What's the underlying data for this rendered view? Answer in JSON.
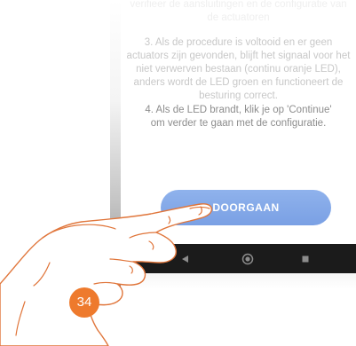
{
  "screen": {
    "previous_step_text": "verifieer de aansluitingen en de configuratie van de actuatoren",
    "step3_text": "3. Als de procedure is voltooid en er geen actuators zijn gevonden, blijft het signaal voor het niet verwerven bestaan (continu oranje LED), anders wordt de LED groen en functioneert de besturing correct.",
    "step4_text": "4. Als de LED brandt, klik je op 'Continue' om verder te gaan met de configuratie.",
    "continue_button_label": "DOORGAAN"
  },
  "navigation_bar": {
    "back_icon": "back-triangle-icon",
    "home_icon": "home-circle-icon",
    "recents_icon": "recents-square-icon"
  },
  "figure": {
    "step_number": "34"
  },
  "colors": {
    "button": "#7aa0e4",
    "badge": "#ee7a2d",
    "navbar": "#1b1b1b"
  }
}
